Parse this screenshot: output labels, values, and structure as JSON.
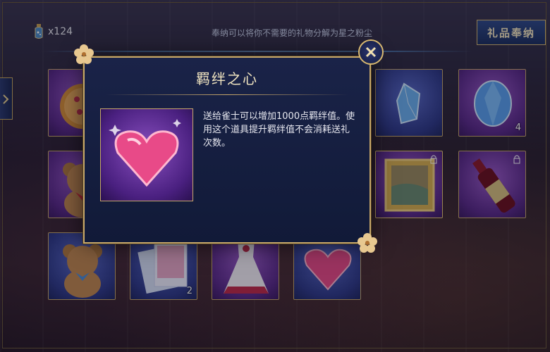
{
  "header": {
    "stardust_count": "x124",
    "hint": "奉纳可以将你不需要的礼物分解为星之粉尘",
    "gift_button_label": "礼品奉纳"
  },
  "dialog": {
    "title": "羁绊之心",
    "description": "送给雀士可以增加1000点羁绊值。使用这个道具提升羁绊值不会消耗送礼次数。"
  },
  "grid": {
    "items": [
      {
        "name": "cookie",
        "count": ""
      },
      {
        "name": "blue-crystal-small",
        "count": ""
      },
      {
        "name": "blue-crystal-large",
        "count": "4"
      },
      {
        "name": "teddy-bear-red",
        "count": ""
      },
      {
        "name": "painting",
        "count": ""
      },
      {
        "name": "wine-bottle",
        "count": ""
      },
      {
        "name": "teddy-bear-blue",
        "count": ""
      },
      {
        "name": "photo-cards",
        "count": "2"
      },
      {
        "name": "dress",
        "count": ""
      },
      {
        "name": "pink-heart",
        "count": ""
      }
    ]
  },
  "colors": {
    "gold": "#c8a86a",
    "panel": "#1a2348",
    "heart": "#e84a88"
  }
}
